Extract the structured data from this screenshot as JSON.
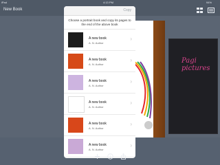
{
  "status_bar": {
    "device": "iPad",
    "time": "4:13 PM",
    "battery": "94%"
  },
  "nav": {
    "title": "New Book",
    "grid_icon": "grid-icon",
    "settings_icon": "settings-icon"
  },
  "popover": {
    "copy_label": "Copy",
    "instructions": "Choose a portrait book and copy its pages to the end of the above book",
    "books": [
      {
        "title": "A new book",
        "author": "A. N. Author",
        "cover_color": "#1c1c1c"
      },
      {
        "title": "A new book",
        "author": "A. N. Author",
        "cover_color": "#d64a18"
      },
      {
        "title": "A new book",
        "author": "A. N. Author",
        "cover_color": "#cdb4e0"
      },
      {
        "title": "A new book",
        "author": "A. N. Author",
        "cover_color": "#ffffff"
      },
      {
        "title": "A new book",
        "author": "A. N. Author",
        "cover_color": "#d8471a"
      },
      {
        "title": "A new book",
        "author": "A. N. Author",
        "cover_color": "#c9a9d6"
      }
    ]
  },
  "shelf": {
    "black_book_title": "Pagi pictures"
  },
  "colors": {
    "navbar": "#4f5966",
    "shelf": "#5b6573",
    "accent": "#d9448c"
  }
}
